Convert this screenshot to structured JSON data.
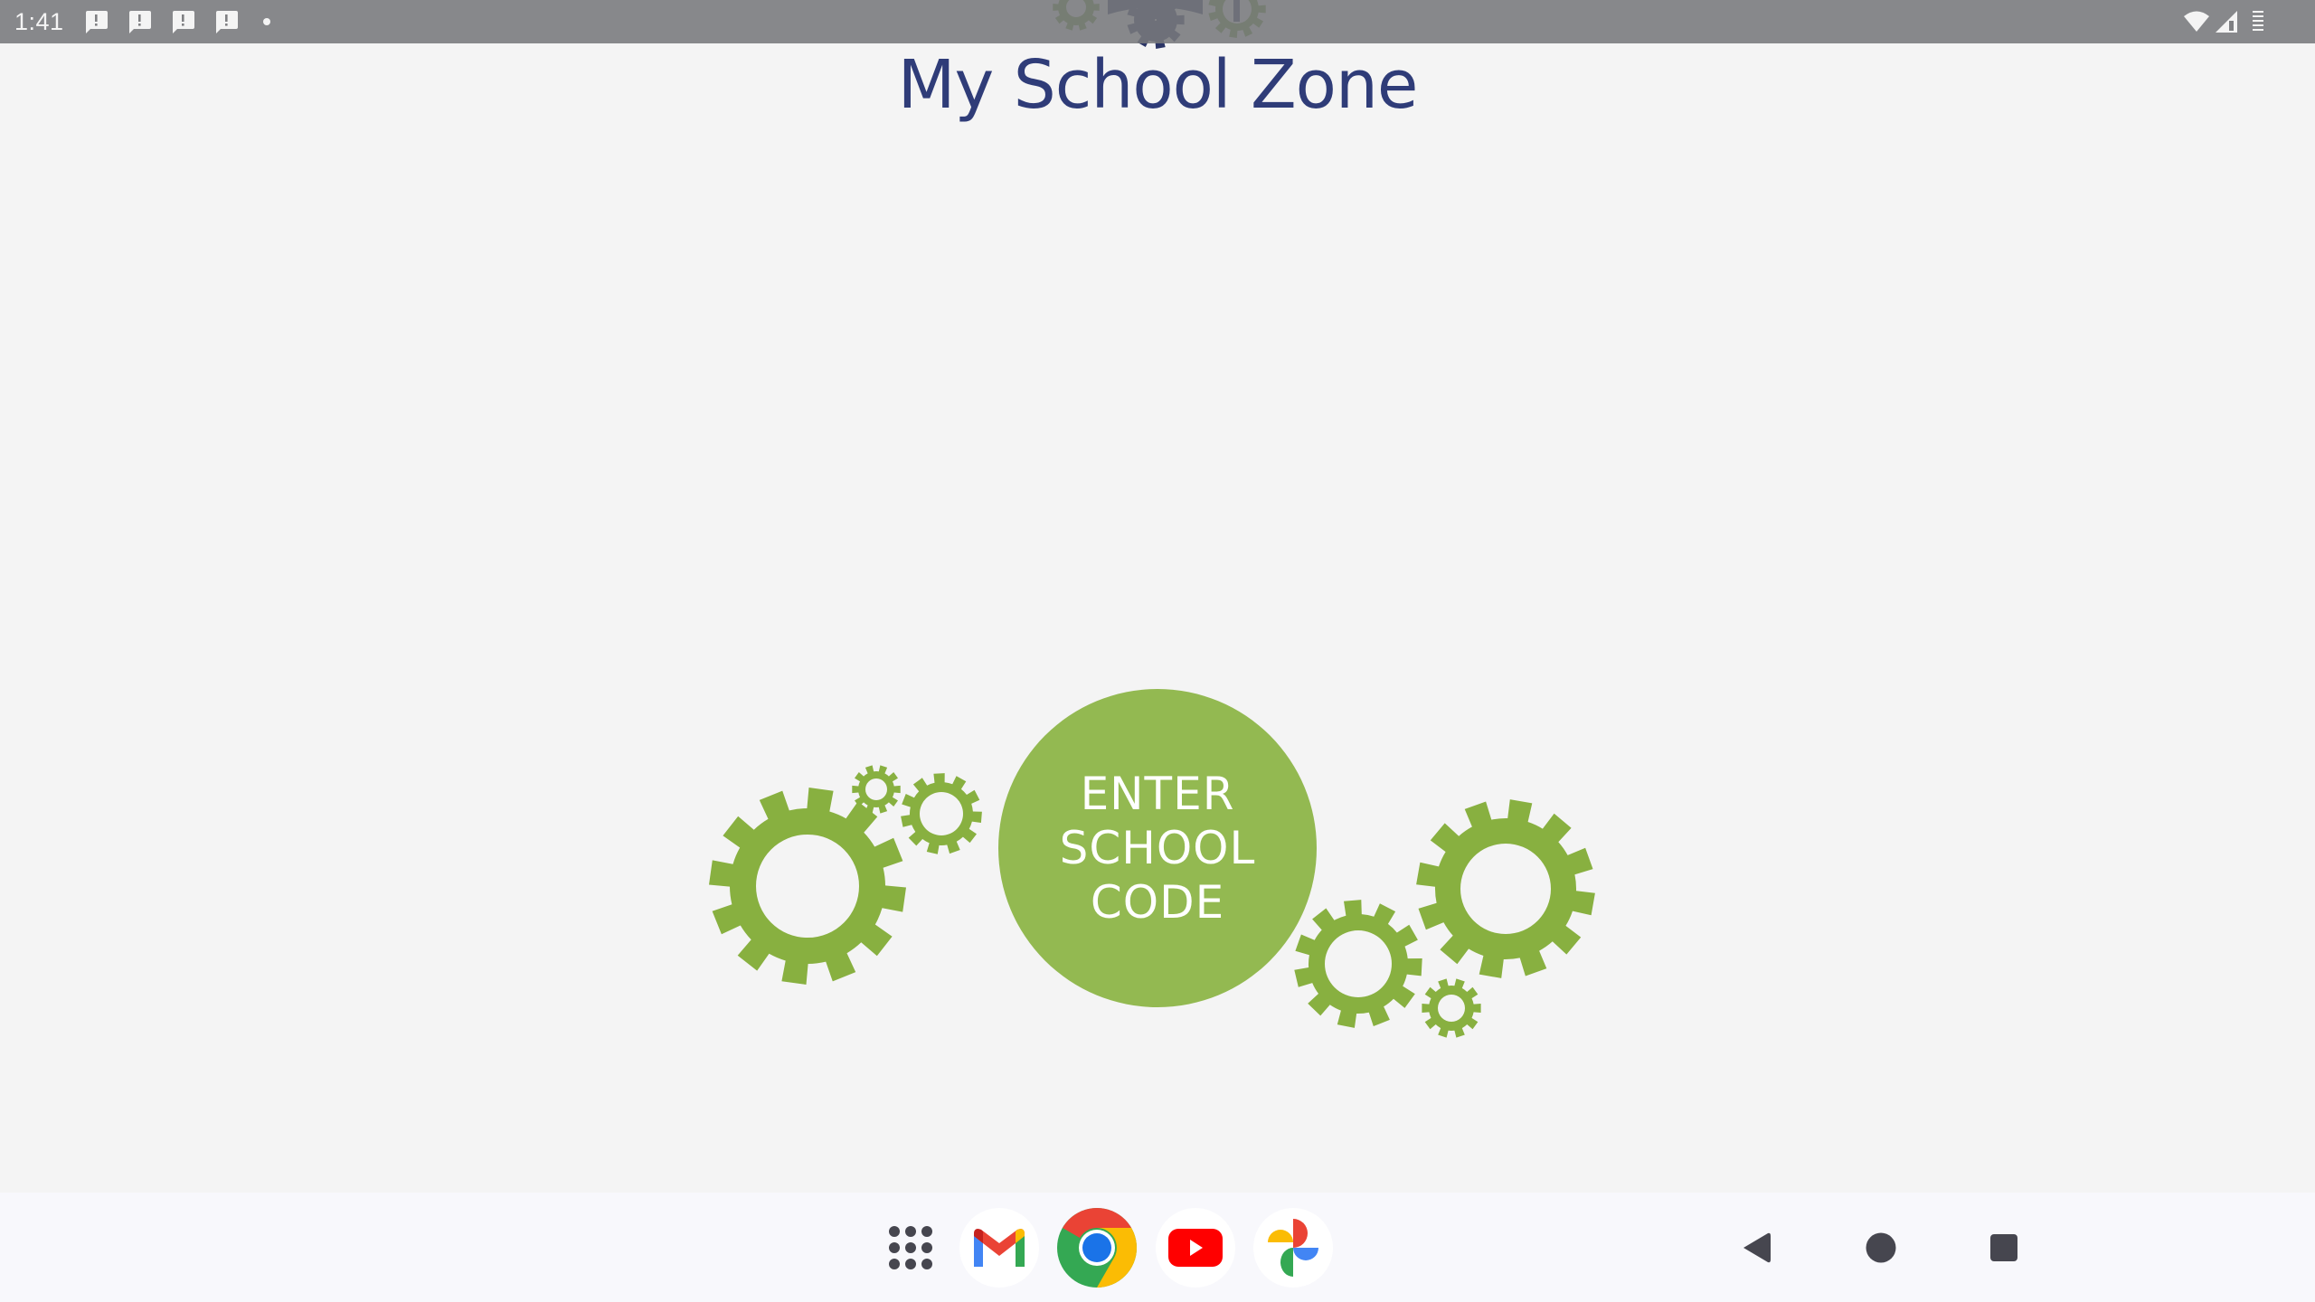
{
  "status_bar": {
    "time": "1:41",
    "notification_icons": [
      "alert-message-icon",
      "alert-message-icon",
      "alert-message-icon",
      "alert-message-icon"
    ],
    "more_notifications_indicator": "dot-icon",
    "system_icons": [
      "wifi-icon",
      "cell-signal-icon",
      "battery-icon"
    ]
  },
  "app": {
    "title": "My School Zone",
    "logo": "school-gears-logo",
    "enter_code_button": {
      "lines": [
        "ENTER",
        "SCHOOL",
        "CODE"
      ]
    },
    "colors": {
      "brand_navy": "#2f3c78",
      "brand_green": "#93b951",
      "gear_green": "#88b040",
      "background": "#f4f4f4"
    }
  },
  "taskbar": {
    "apps": [
      {
        "name": "App drawer",
        "icon": "grid-icon"
      },
      {
        "name": "Gmail",
        "icon": "gmail-icon"
      },
      {
        "name": "Chrome",
        "icon": "chrome-icon"
      },
      {
        "name": "YouTube",
        "icon": "youtube-icon"
      },
      {
        "name": "Photos",
        "icon": "photos-icon"
      }
    ],
    "navigation": [
      {
        "name": "Back",
        "icon": "back-icon"
      },
      {
        "name": "Home",
        "icon": "home-icon"
      },
      {
        "name": "Recents",
        "icon": "recents-icon"
      }
    ]
  }
}
